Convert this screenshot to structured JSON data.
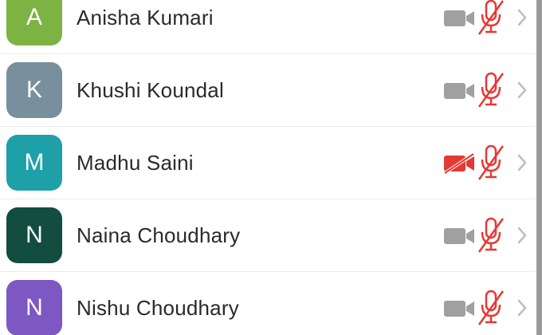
{
  "participants": [
    {
      "initial": "A",
      "name": "Anisha Kumari",
      "avatar_color": "#7cb342",
      "camera": "off",
      "mic": "muted"
    },
    {
      "initial": "K",
      "name": "Khushi Koundal",
      "avatar_color": "#7a8f9e",
      "camera": "off",
      "mic": "muted"
    },
    {
      "initial": "M",
      "name": "Madhu Saini",
      "avatar_color": "#1da0a8",
      "camera": "disabled",
      "mic": "muted"
    },
    {
      "initial": "N",
      "name": "Naina Choudhary",
      "avatar_color": "#124d3f",
      "camera": "off",
      "mic": "muted"
    },
    {
      "initial": "N",
      "name": "Nishu Choudhary",
      "avatar_color": "#7d57c2",
      "camera": "off",
      "mic": "muted"
    }
  ],
  "colors": {
    "camera_off": "#a0a0a0",
    "camera_disabled": "#e53935",
    "mic_muted": "#e53935",
    "chevron": "#bdbdbd",
    "text": "#2a2a2a"
  },
  "icons": {
    "camera": "video-camera-icon",
    "mic": "microphone-muted-icon",
    "chevron": "chevron-right-icon"
  }
}
